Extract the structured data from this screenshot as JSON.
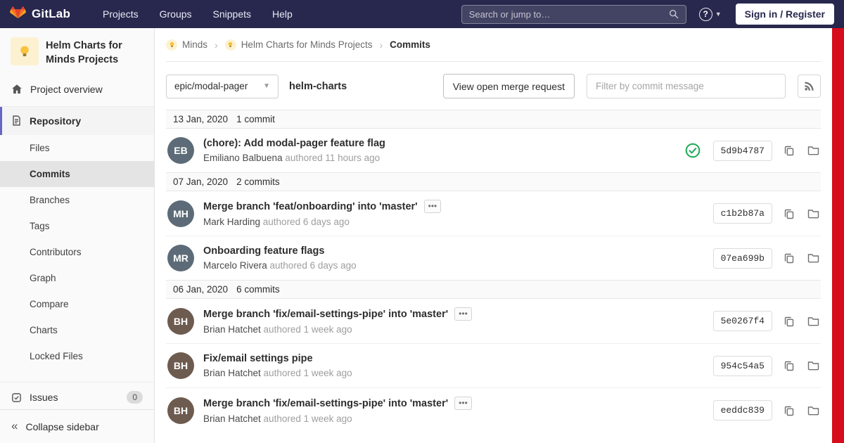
{
  "colors": {
    "navbar_bg": "#28284e",
    "scroll_stripe_red": "#d60d1c",
    "active_accent_purple": "#6666c4",
    "pipeline_success_green": "#1aaa55"
  },
  "navbar": {
    "brand": "GitLab",
    "menu": [
      {
        "label": "Projects"
      },
      {
        "label": "Groups"
      },
      {
        "label": "Snippets"
      },
      {
        "label": "Help"
      }
    ],
    "search_placeholder": "Search or jump to…",
    "sign_in_label": "Sign in / Register"
  },
  "sidebar": {
    "project": {
      "title": "Helm Charts for Minds Projects",
      "avatar_icon": "lightbulb"
    },
    "overview_label": "Project overview",
    "repository_label": "Repository",
    "repository_items": [
      {
        "label": "Files",
        "active": false
      },
      {
        "label": "Commits",
        "active": true
      },
      {
        "label": "Branches",
        "active": false
      },
      {
        "label": "Tags",
        "active": false
      },
      {
        "label": "Contributors",
        "active": false
      },
      {
        "label": "Graph",
        "active": false
      },
      {
        "label": "Compare",
        "active": false
      },
      {
        "label": "Charts",
        "active": false
      },
      {
        "label": "Locked Files",
        "active": false
      }
    ],
    "issues_label": "Issues",
    "issues_count": "0",
    "collapse_label": "Collapse sidebar"
  },
  "breadcrumbs": {
    "items": [
      {
        "label": "Minds",
        "avatar_icon": "lightbulb"
      },
      {
        "label": "Helm Charts for Minds Projects",
        "avatar_icon": "lightbulb"
      },
      {
        "label": "Commits"
      }
    ]
  },
  "controls": {
    "branch_selector": "epic/modal-pager",
    "path_label": "helm-charts",
    "view_mr_label": "View open merge request",
    "filter_placeholder": "Filter by commit message"
  },
  "commit_groups": [
    {
      "date": "13 Jan, 2020",
      "count_label": "1 commit",
      "commits": [
        {
          "title": "(chore): Add modal-pager feature flag",
          "author": "Emiliano Balbuena",
          "authored": "authored 11 hours ago",
          "sha": "5d9b4787",
          "pipeline_passed": true,
          "merge_ellipsis": false
        }
      ]
    },
    {
      "date": "07 Jan, 2020",
      "count_label": "2 commits",
      "commits": [
        {
          "title": "Merge branch 'feat/onboarding' into 'master'",
          "author": "Mark Harding",
          "authored": "authored 6 days ago",
          "sha": "c1b2b87a",
          "pipeline_passed": false,
          "merge_ellipsis": true
        },
        {
          "title": "Onboarding feature flags",
          "author": "Marcelo Rivera",
          "authored": "authored 6 days ago",
          "sha": "07ea699b",
          "pipeline_passed": false,
          "merge_ellipsis": false
        }
      ]
    },
    {
      "date": "06 Jan, 2020",
      "count_label": "6 commits",
      "commits": [
        {
          "title": "Merge branch 'fix/email-settings-pipe' into 'master'",
          "author": "Brian Hatchet",
          "authored": "authored 1 week ago",
          "sha": "5e0267f4",
          "pipeline_passed": false,
          "merge_ellipsis": true
        },
        {
          "title": "Fix/email settings pipe",
          "author": "Brian Hatchet",
          "authored": "authored 1 week ago",
          "sha": "954c54a5",
          "pipeline_passed": false,
          "merge_ellipsis": false
        },
        {
          "title": "Merge branch 'fix/email-settings-pipe' into 'master'",
          "author": "Brian Hatchet",
          "authored": "authored 1 week ago",
          "sha": "eeddc839",
          "pipeline_passed": false,
          "merge_ellipsis": true
        }
      ]
    }
  ]
}
